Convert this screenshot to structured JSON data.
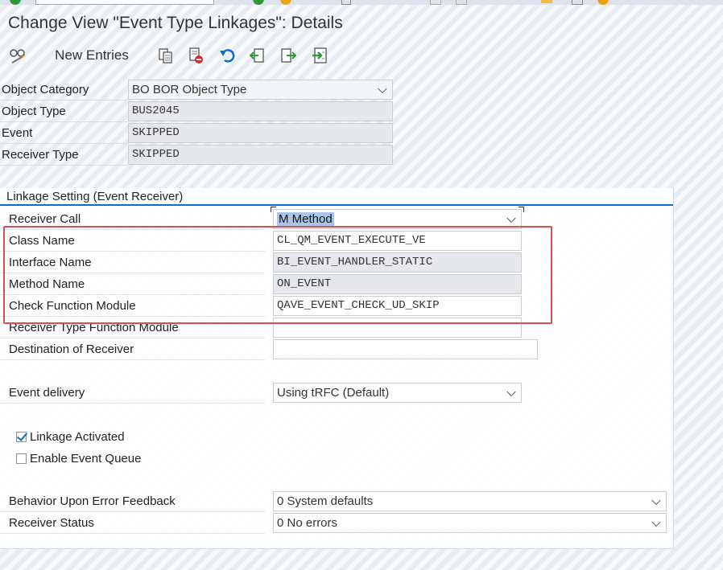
{
  "window": {
    "title": "Change View \"Event Type Linkages\": Details"
  },
  "toolbar": {
    "new_entries_label": "New Entries",
    "icons": [
      "display-change-icon",
      "copy-icon",
      "delete-icon",
      "undo-icon",
      "previous-entry-icon",
      "next-entry-icon",
      "select-all-icon"
    ]
  },
  "header_fields": {
    "object_category": {
      "label": "Object Category",
      "value": "BO BOR Object Type"
    },
    "object_type": {
      "label": "Object Type",
      "value": "BUS2045"
    },
    "event": {
      "label": "Event",
      "value": "SKIPPED"
    },
    "receiver_type": {
      "label": "Receiver Type",
      "value": "SKIPPED"
    }
  },
  "linkage": {
    "group_title": "Linkage Setting (Event Receiver)",
    "receiver_call": {
      "label": "Receiver Call",
      "value": "M Method"
    },
    "class_name": {
      "label": "Class Name",
      "value": "CL_QM_EVENT_EXECUTE_VE"
    },
    "interface_name": {
      "label": "Interface Name",
      "value": "BI_EVENT_HANDLER_STATIC"
    },
    "method_name": {
      "label": "Method Name",
      "value": "ON_EVENT"
    },
    "check_function_module": {
      "label": "Check Function Module",
      "value": "QAVE_EVENT_CHECK_UD_SKIP"
    },
    "receiver_type_function_module": {
      "label": "Receiver Type Function Module",
      "value": ""
    },
    "destination_of_receiver": {
      "label": "Destination of Receiver",
      "value": ""
    },
    "event_delivery": {
      "label": "Event delivery",
      "value": "Using tRFC (Default)"
    },
    "linkage_activated": {
      "label": "Linkage Activated",
      "checked": true
    },
    "enable_event_queue": {
      "label": "Enable Event Queue",
      "checked": false
    },
    "behavior_upon_error": {
      "label": "Behavior Upon Error Feedback",
      "value": "0 System defaults"
    },
    "receiver_status": {
      "label": "Receiver Status",
      "value": "0 No errors"
    }
  },
  "colors": {
    "accent": "#0a6ed1",
    "highlight_box": "#e04b52",
    "readonly_field": "#e6e8eb"
  }
}
